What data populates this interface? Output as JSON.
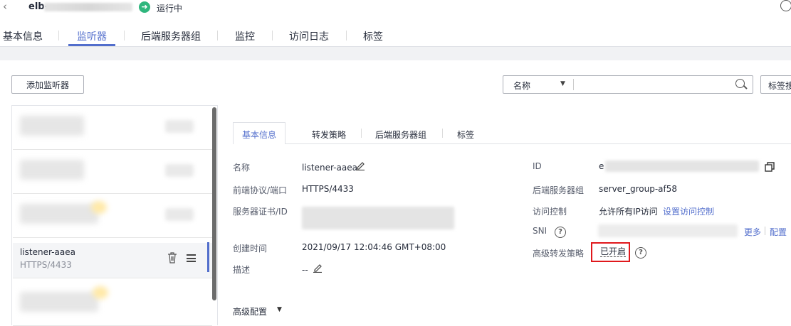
{
  "header": {
    "lb_name_prefix": "elb-",
    "status": "运行中",
    "status_color": "#2eb67d"
  },
  "main_tabs": [
    {
      "label": "基本信息",
      "active": false
    },
    {
      "label": "监听器",
      "active": true
    },
    {
      "label": "后端服务器组",
      "active": false
    },
    {
      "label": "监控",
      "active": false
    },
    {
      "label": "访问日志",
      "active": false
    },
    {
      "label": "标签",
      "active": false
    }
  ],
  "toolbar": {
    "add_listener_label": "添加监听器",
    "search_field_select": "名称",
    "tag_search_label": "标签搜"
  },
  "listener_list": {
    "selected": {
      "name": "listener-aaea",
      "protocol_port": "HTTPS/4433"
    }
  },
  "detail_tabs": [
    {
      "label": "基本信息",
      "active": true
    },
    {
      "label": "转发策略",
      "active": false
    },
    {
      "label": "后端服务器组",
      "active": false
    },
    {
      "label": "标签",
      "active": false
    }
  ],
  "details": {
    "name_label": "名称",
    "name_value": "listener-aaea",
    "protocol_label": "前端协议/端口",
    "protocol_value": "HTTPS/4433",
    "cert_label": "服务器证书/ID",
    "created_label": "创建时间",
    "created_value": "2021/09/17 12:04:46 GMT+08:00",
    "desc_label": "描述",
    "desc_value": "--",
    "id_label": "ID",
    "id_value_prefix": "e",
    "backend_group_label": "后端服务器组",
    "backend_group_value": "server_group-af58",
    "access_control_label": "访问控制",
    "access_control_value": "允许所有IP访问",
    "access_control_link": "设置访问控制",
    "sni_label": "SNI",
    "sni_more_link": "更多",
    "sni_config_link": "配置",
    "adv_forward_label": "高级转发策略",
    "adv_forward_value": "已开启",
    "highlight_color": "#e0181c"
  },
  "advanced_config_label": "高级配置",
  "accent_color": "#526ecc"
}
